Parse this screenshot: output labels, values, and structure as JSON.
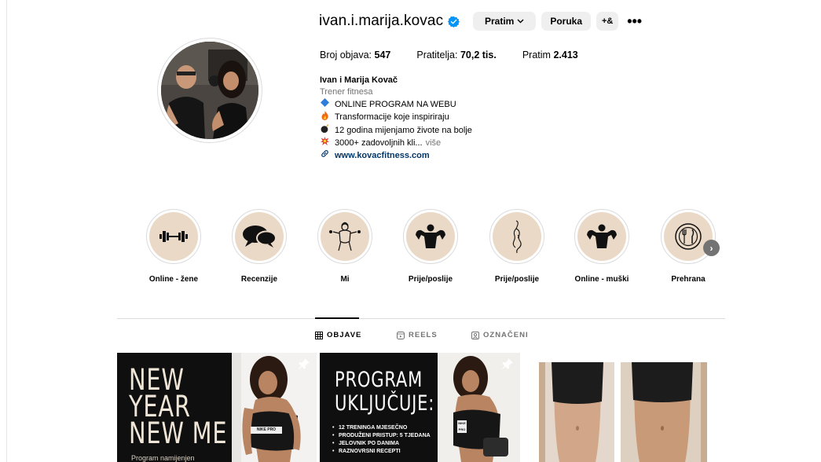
{
  "profile": {
    "username": "ivan.i.marija.kovac",
    "follow_button": "Pratim",
    "message_button": "Poruka",
    "add_user_glyph": "+&",
    "more_glyph": "•••",
    "stats": [
      {
        "label": "Broj objava:",
        "value": "547"
      },
      {
        "label": "Pratitelja:",
        "value": "70,2 tis."
      },
      {
        "label": "Pratim",
        "value": "2.413"
      }
    ],
    "bio": {
      "name": "Ivan i Marija Kovač",
      "category": "Trener fitnesa",
      "lines": [
        {
          "icon": "blue-diamond-icon",
          "text": "ONLINE PROGRAM NA WEBU"
        },
        {
          "icon": "fire-icon",
          "text": "Transformacije koje inspiriraju"
        },
        {
          "icon": "bomb-icon",
          "text": "12 godina mijenjamo živote na bolje"
        },
        {
          "icon": "collision-icon",
          "text": "3000+ zadovoljnih kli...",
          "more": "više"
        }
      ],
      "link": "www.kovacfitness.com"
    }
  },
  "highlights": [
    {
      "label": "Online - žene",
      "icon": "dumbbell-icon"
    },
    {
      "label": "Recenzije",
      "icon": "speech-bubbles-icon"
    },
    {
      "label": "Mi",
      "icon": "couple-icon"
    },
    {
      "label": "Prije/poslije",
      "icon": "muscle-torso-icon"
    },
    {
      "label": "Prije/poslije",
      "icon": "female-silhouette-icon"
    },
    {
      "label": "Online - muški",
      "icon": "muscle-torso-icon"
    },
    {
      "label": "Prehrana",
      "icon": "plate-cutlery-icon"
    }
  ],
  "tabs": [
    {
      "label": "OBJAVE",
      "icon": "grid-icon",
      "active": true
    },
    {
      "label": "REELS",
      "icon": "reels-icon",
      "active": false
    },
    {
      "label": "OZNAČENI",
      "icon": "tagged-icon",
      "active": false
    }
  ],
  "posts": {
    "post1": {
      "lines": [
        "NEW",
        "YEAR",
        "NEW ME"
      ],
      "subtitle": "Program namijenjen",
      "shirt_text": "NIKE PRO"
    },
    "post2": {
      "title_lines": [
        "PROGRAM",
        "UKLJUČUJE:"
      ],
      "items": [
        "12 TRENINGA MJESEČNO",
        "PRODUŽENI PRISTUP: 5 TJEDANA",
        "JELOVNIK PO DANIMA",
        "RAZNOVRSNI RECEPTI"
      ],
      "shirt_text": "NIKE PRO"
    }
  },
  "colors": {
    "verified": "#0095f6",
    "highlight_bg": "#ead9c6",
    "link": "#00376b",
    "secondary_text": "#737373"
  }
}
